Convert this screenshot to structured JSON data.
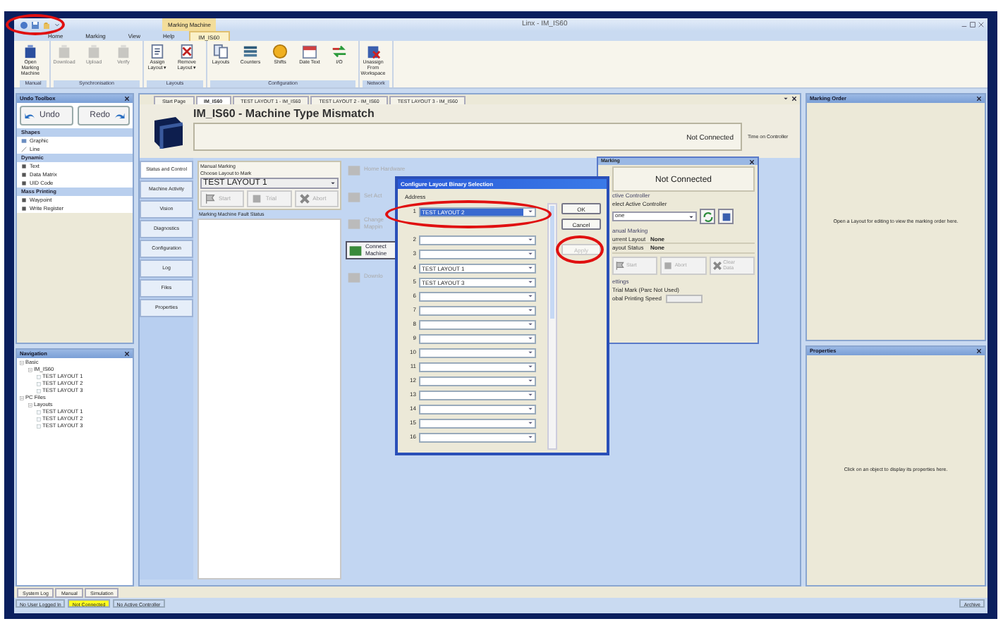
{
  "window": {
    "title": "Linx - IM_IS60",
    "quick_access_circled": true
  },
  "ribbon": {
    "context_group": "Marking Machine",
    "tabs": [
      {
        "label": "Home",
        "selected": false
      },
      {
        "label": "Marking",
        "selected": false
      },
      {
        "label": "View",
        "selected": false
      },
      {
        "label": "Help",
        "selected": false
      },
      {
        "label": "IM_IS60",
        "selected": true
      }
    ],
    "groups": [
      {
        "label": "Manual",
        "buttons": [
          {
            "label": "Open Marking Machine",
            "disabled": false
          }
        ]
      },
      {
        "label": "Synchronisation",
        "buttons": [
          {
            "label": "Download",
            "disabled": true
          },
          {
            "label": "Upload",
            "disabled": true
          },
          {
            "label": "Verify",
            "disabled": true
          }
        ]
      },
      {
        "label": "Layouts",
        "buttons": [
          {
            "label": "Assign Layout ▾",
            "disabled": false
          },
          {
            "label": "Remove Layout ▾",
            "disabled": false
          }
        ]
      },
      {
        "label": "Configuration",
        "buttons": [
          {
            "label": "Layouts",
            "disabled": false
          },
          {
            "label": "Counters",
            "disabled": false
          },
          {
            "label": "Shifts",
            "disabled": false
          },
          {
            "label": "Date Text",
            "disabled": false
          },
          {
            "label": "I/O",
            "disabled": false
          }
        ]
      },
      {
        "label": "Network",
        "buttons": [
          {
            "label": "Unassign From Workspace",
            "disabled": false
          }
        ]
      }
    ]
  },
  "toolbox": {
    "title": "Undo Toolbox",
    "undo": "Undo",
    "redo": "Redo",
    "sections": [
      {
        "title": "Shapes",
        "items": [
          "Graphic",
          "Line"
        ]
      },
      {
        "title": "Dynamic",
        "items": [
          "Text",
          "Data Matrix",
          "UID Code"
        ]
      },
      {
        "title": "Mass Printing",
        "items": [
          "Waypoint",
          "Write Register"
        ]
      }
    ]
  },
  "navigation": {
    "title": "Navigation",
    "tree": [
      {
        "label": "Basic",
        "expanded": true,
        "children": [
          {
            "label": "IM_IS60",
            "expanded": true,
            "children": [
              {
                "label": "TEST LAYOUT 1"
              },
              {
                "label": "TEST LAYOUT 2"
              },
              {
                "label": "TEST LAYOUT 3"
              }
            ]
          }
        ]
      },
      {
        "label": "PC Files",
        "expanded": true,
        "children": [
          {
            "label": "Layouts",
            "expanded": true,
            "children": [
              {
                "label": "TEST LAYOUT 1"
              },
              {
                "label": "TEST LAYOUT 2"
              },
              {
                "label": "TEST LAYOUT 3"
              }
            ]
          }
        ]
      }
    ]
  },
  "document": {
    "tabs": [
      {
        "label": "Start Page",
        "selected": false
      },
      {
        "label": "IM_IS60",
        "selected": true
      },
      {
        "label": "TEST LAYOUT 1 - IM_IS60",
        "selected": false
      },
      {
        "label": "TEST LAYOUT 2 - IM_IS60",
        "selected": false
      },
      {
        "label": "TEST LAYOUT 3 - IM_IS60",
        "selected": false
      }
    ],
    "machine_title": "IM_IS60 - Machine Type Mismatch",
    "connection": "Not Connected",
    "time_label": "Time on Controller",
    "side_tabs": [
      {
        "label": "Status and Control",
        "selected": true
      },
      {
        "label": "Machine Activity",
        "selected": false
      },
      {
        "label": "Vision",
        "selected": false
      },
      {
        "label": "Diagnostics",
        "selected": false
      },
      {
        "label": "Configuration",
        "selected": false
      },
      {
        "label": "Log",
        "selected": false
      },
      {
        "label": "Files",
        "selected": false
      },
      {
        "label": "Properties",
        "selected": false
      }
    ],
    "manual_marking": {
      "title": "Manual Marking",
      "prompt": "Choose Layout to Mark",
      "layout": "TEST LAYOUT 1",
      "buttons": [
        {
          "label": "Start",
          "disabled": true
        },
        {
          "label": "Trial",
          "disabled": true
        },
        {
          "label": "Abort",
          "disabled": true
        }
      ],
      "fault_title": "Marking Machine Fault Status"
    },
    "actions": [
      {
        "label": "Home Hardware",
        "disabled": true
      },
      {
        "label": "Set Act",
        "disabled": true
      },
      {
        "label": "Change\nMappin",
        "disabled": true
      },
      {
        "label": "Connect\nMachine",
        "disabled": false
      },
      {
        "label": "Downlo",
        "disabled": true
      }
    ]
  },
  "marking_panel": {
    "title": "Marking",
    "connection": "Not Connected",
    "controller_title": "ctive Controller",
    "controller_prompt": "elect Active Controller",
    "controller": "one",
    "layout_title": "anual Marking",
    "rows": [
      {
        "label": "urrent Layout",
        "value": "None"
      },
      {
        "label": "ayout Status",
        "value": "None"
      }
    ],
    "buttons": [
      {
        "label": "Start",
        "disabled": true
      },
      {
        "label": "Abort",
        "disabled": true
      },
      {
        "label": "Clear\nData",
        "disabled": true
      }
    ],
    "settings_title": "ettings",
    "trial_mark": "Trial Mark (Parc Not Used)",
    "speed_label": "obal Printing Speed"
  },
  "dialog": {
    "title": "Configure Layout Binary Selection",
    "address_label": "Address",
    "rows": [
      {
        "number": "1",
        "layout": "TEST LAYOUT 2",
        "selected": true,
        "circled": true
      },
      {
        "number": "2",
        "selected": false,
        "circled": false
      },
      {
        "number": "3",
        "selected": false,
        "circled": false
      },
      {
        "number": "4",
        "layout": "TEST LAYOUT 1",
        "selected": false,
        "circled": false
      },
      {
        "number": "5",
        "layout": "TEST LAYOUT 3",
        "selected": false,
        "circled": false
      },
      {
        "number": "6",
        "selected": false,
        "circled": false
      },
      {
        "number": "7",
        "selected": false,
        "circled": false
      },
      {
        "number": "8",
        "selected": false,
        "circled": false
      },
      {
        "number": "9",
        "selected": false,
        "circled": false
      },
      {
        "number": "10",
        "selected": false,
        "circled": false
      },
      {
        "number": "11",
        "selected": false,
        "circled": false
      },
      {
        "number": "12",
        "selected": false,
        "circled": false
      },
      {
        "number": "13",
        "selected": false,
        "circled": false
      },
      {
        "number": "14",
        "selected": false,
        "circled": false
      },
      {
        "number": "15",
        "selected": false,
        "circled": false
      },
      {
        "number": "16",
        "selected": false,
        "circled": false
      }
    ],
    "buttons": [
      {
        "label": "OK",
        "disabled": false,
        "circled": false
      },
      {
        "label": "Cancel",
        "disabled": false,
        "circled": false
      },
      {
        "label": "Apply",
        "disabled": true,
        "circled": true
      }
    ]
  },
  "marking_order": {
    "title": "Marking Order",
    "message": "Open a Layout for editing to view the marking order here."
  },
  "properties": {
    "title": "Properties",
    "message": "Click on an object to display its properties here."
  },
  "bottom_tabs": [
    "System Log",
    "Manual",
    "Simulation"
  ],
  "status_bar": {
    "items": [
      {
        "text": "No User Logged In",
        "highlighted": false
      },
      {
        "text": "Not Connected",
        "highlighted": true
      },
      {
        "text": "No Active Controller",
        "highlighted": false
      }
    ],
    "right": "Archive"
  }
}
